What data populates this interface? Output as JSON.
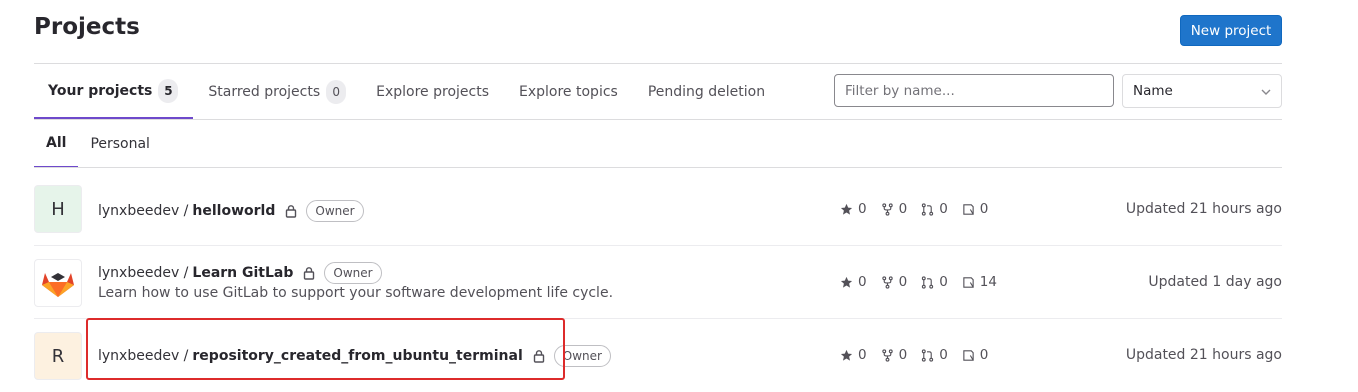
{
  "page": {
    "title": "Projects",
    "new_project_label": "New project"
  },
  "tabs": [
    {
      "label": "Your projects",
      "count": "5"
    },
    {
      "label": "Starred projects",
      "count": "0"
    },
    {
      "label": "Explore projects"
    },
    {
      "label": "Explore topics"
    },
    {
      "label": "Pending deletion"
    }
  ],
  "filter": {
    "placeholder": "Filter by name..."
  },
  "sort": {
    "selected": "Name"
  },
  "subtabs": [
    {
      "label": "All"
    },
    {
      "label": "Personal"
    }
  ],
  "projects": [
    {
      "avatar_letter": "H",
      "namespace": "lynxbeedev /",
      "name": "helloworld",
      "role": "Owner",
      "description": "",
      "stars": "0",
      "forks": "0",
      "merge_requests": "0",
      "issues": "0",
      "updated": "Updated 21 hours ago"
    },
    {
      "avatar_letter": "",
      "namespace": "lynxbeedev /",
      "name": "Learn GitLab",
      "role": "Owner",
      "description": "Learn how to use GitLab to support your software development life cycle.",
      "stars": "0",
      "forks": "0",
      "merge_requests": "0",
      "issues": "14",
      "updated": "Updated 1 day ago"
    },
    {
      "avatar_letter": "R",
      "namespace": "lynxbeedev /",
      "name": "repository_created_from_ubuntu_terminal",
      "role": "Owner",
      "description": "",
      "stars": "0",
      "forks": "0",
      "merge_requests": "0",
      "issues": "0",
      "updated": "Updated 21 hours ago"
    }
  ],
  "colors": {
    "accent": "#6e49cb",
    "primary_button": "#1f75cb",
    "highlight_box": "#dd2b2b"
  },
  "icons": {
    "star": "star-icon",
    "fork": "fork-icon",
    "merge_request": "merge-request-icon",
    "issue": "issues-icon",
    "lock": "lock-icon",
    "chevron": "chevron-down-icon",
    "logo": "gitlab-logo-icon"
  }
}
